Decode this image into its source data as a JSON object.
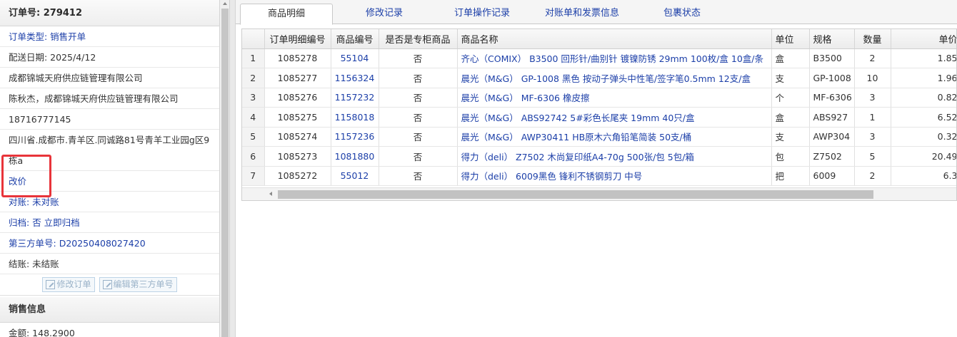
{
  "left": {
    "order_no_label": "订单号: 279412",
    "order_type": "订单类型: 销售开单",
    "delivery_date": "配送日期: 2025/4/12",
    "company": "成都锦城天府供应链管理有限公司",
    "contact": "陈秋杰，成都锦城天府供应链管理有限公司",
    "phone": "18716777145",
    "address": "四川省.成都市.青羊区.同诚路81号青羊工业园g区9栋a",
    "change_price": "改价",
    "reconcile": "对账: 未对账",
    "archive_label": "归档: ",
    "archive_value": "否 立即归档",
    "third_party_label": "第三方单号: ",
    "third_party_value": "D20250408027420",
    "settlement": "结账: 未结账",
    "modify_order_btn": "修改订单",
    "edit_third_party_btn": "编辑第三方单号",
    "sales_info_title": "销售信息",
    "amount": "金额: 148.2900"
  },
  "tabs": [
    "商品明细",
    "修改记录",
    "订单操作记录",
    "对账单和发票信息",
    "包裹状态"
  ],
  "table": {
    "headers": [
      "",
      "订单明细编号",
      "商品编号",
      "是否是专柜商品",
      "商品名称",
      "单位",
      "规格",
      "数量",
      "单价"
    ],
    "rows": [
      [
        "1",
        "1085278",
        "55104",
        "否",
        "齐心（COMIX） B3500 回形针/曲别针 镀镍防锈 29mm 100枚/盒 10盒/条",
        "盒",
        "B3500",
        "2",
        "1.85"
      ],
      [
        "2",
        "1085277",
        "1156324",
        "否",
        "晨光（M&G） GP-1008 黑色 按动子弹头中性笔/签字笔0.5mm 12支/盒",
        "支",
        "GP-1008",
        "10",
        "1.96"
      ],
      [
        "3",
        "1085276",
        "1157232",
        "否",
        "晨光（M&G） MF-6306 橡皮擦",
        "个",
        "MF-6306",
        "3",
        "0.82"
      ],
      [
        "4",
        "1085275",
        "1158018",
        "否",
        "晨光（M&G） ABS92742 5#彩色长尾夹 19mm 40只/盒",
        "盒",
        "ABS927",
        "1",
        "6.52"
      ],
      [
        "5",
        "1085274",
        "1157236",
        "否",
        "晨光（M&G） AWP30411 HB原木六角铅笔简装 50支/桶",
        "支",
        "AWP304",
        "3",
        "0.32"
      ],
      [
        "6",
        "1085273",
        "1081880",
        "否",
        "得力（deli） Z7502 木尚复印纸A4-70g 500张/包 5包/箱",
        "包",
        "Z7502",
        "5",
        "20.49"
      ],
      [
        "7",
        "1085272",
        "55012",
        "否",
        "得力（deli） 6009黑色 锋利不锈钢剪刀 中号",
        "把",
        "6009",
        "2",
        "6.3"
      ]
    ]
  }
}
